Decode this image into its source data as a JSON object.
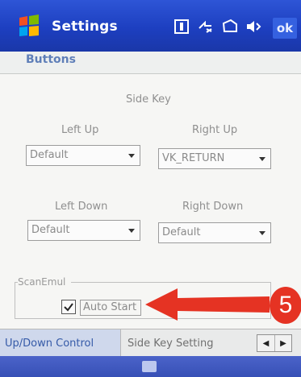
{
  "titlebar": {
    "title": "Settings",
    "ok_label": "ok",
    "icons": [
      "windows-start-icon",
      "input-panel-icon",
      "connectivity-icon",
      "battery-icon",
      "volume-icon"
    ]
  },
  "page": {
    "header": "Buttons",
    "section_title": "Side Key"
  },
  "keys": {
    "left_up": {
      "label": "Left Up",
      "value": "Default"
    },
    "right_up": {
      "label": "Right Up",
      "value": "VK_RETURN"
    },
    "left_down": {
      "label": "Left Down",
      "value": "Default"
    },
    "right_down": {
      "label": "Right Down",
      "value": "Default"
    }
  },
  "scan_emul": {
    "legend": "ScanEmul",
    "auto_start_label": "Auto Start",
    "auto_start_checked": true
  },
  "annotation": {
    "step": "5",
    "color": "#e53323"
  },
  "tabs": [
    {
      "label": "Up/Down Control",
      "active": true
    },
    {
      "label": "Side Key Setting",
      "active": false
    }
  ],
  "colors": {
    "titlebar": "#1d3fc0",
    "header_text": "#5f7fb8",
    "accent": "#355aa8"
  }
}
